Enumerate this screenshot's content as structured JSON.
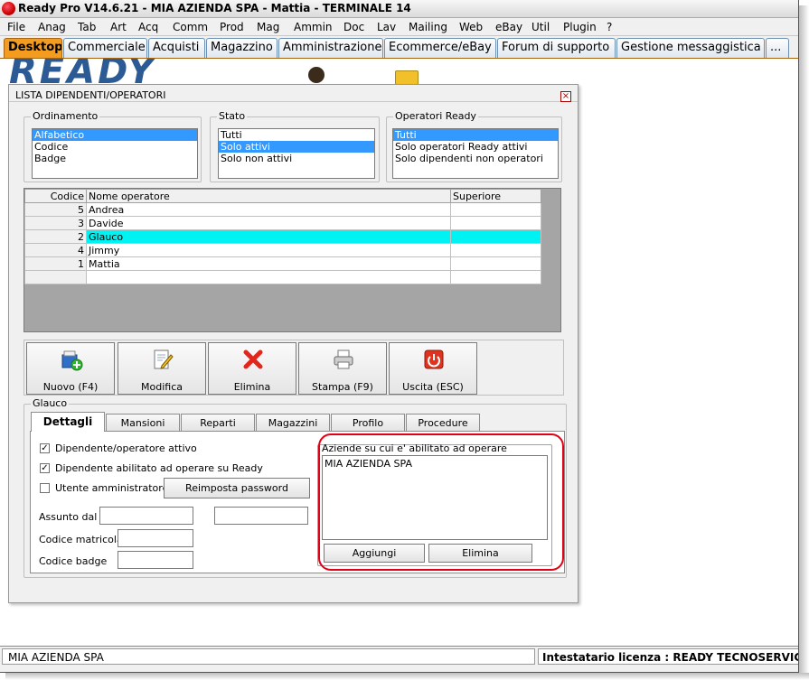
{
  "window": {
    "title": "Ready Pro V14.6.21 - MIA AZIENDA SPA - Mattia - TERMINALE 14"
  },
  "menu": [
    "File",
    "Anag",
    "Tab",
    "Art",
    "Acq",
    "Comm",
    "Prod",
    "Mag",
    "Ammin",
    "Doc",
    "Lav",
    "Mailing",
    "Web",
    "eBay",
    "Util",
    "Plugin",
    "?"
  ],
  "app_tabs": [
    "Desktop",
    "Commerciale",
    "Acquisti",
    "Magazzino",
    "Amministrazione",
    "Ecommerce/eBay",
    "Forum di supporto",
    "Gestione messaggistica",
    "..."
  ],
  "desktop": {
    "logo": "READY"
  },
  "dialog": {
    "title": "LISTA DIPENDENTI/OPERATORI",
    "close_glyph": "×",
    "ordinamento": {
      "label": "Ordinamento",
      "options": [
        "Alfabetico",
        "Codice",
        "Badge"
      ],
      "selected": 0
    },
    "stato": {
      "label": "Stato",
      "options": [
        "Tutti",
        "Solo attivi",
        "Solo non attivi"
      ],
      "selected": 1
    },
    "operatori": {
      "label": "Operatori Ready",
      "options": [
        "Tutti",
        "Solo operatori Ready attivi",
        "Solo dipendenti non operatori"
      ],
      "selected": 0
    },
    "grid": {
      "headers": [
        "Codice",
        "Nome operatore",
        "Superiore"
      ],
      "rows": [
        {
          "code": "5",
          "name": "Andrea",
          "sup": ""
        },
        {
          "code": "3",
          "name": "Davide",
          "sup": ""
        },
        {
          "code": "2",
          "name": "Glauco",
          "sup": ""
        },
        {
          "code": "4",
          "name": "Jimmy",
          "sup": ""
        },
        {
          "code": "1",
          "name": "Mattia",
          "sup": ""
        },
        {
          "code": "",
          "name": "",
          "sup": ""
        }
      ],
      "selected_row": 2
    },
    "toolbar": [
      {
        "label": "Nuovo (F4)",
        "icon": "new-icon"
      },
      {
        "label": "Modifica",
        "icon": "edit-icon"
      },
      {
        "label": "Elimina",
        "icon": "delete-icon"
      },
      {
        "label": "Stampa (F9)",
        "icon": "printer-icon"
      },
      {
        "label": "Uscita (ESC)",
        "icon": "exit-icon"
      }
    ],
    "detail": {
      "group_label": "Glauco",
      "tabs": [
        "Dettagli",
        "Mansioni",
        "Reparti",
        "Magazzini",
        "Profilo",
        "Procedure"
      ],
      "active_tab": 0,
      "checkboxes": [
        {
          "label": "Dipendente/operatore attivo",
          "checked": true
        },
        {
          "label": "Dipendente abilitato ad operare su Ready",
          "checked": true
        },
        {
          "label": "Utente amministratore",
          "checked": false
        }
      ],
      "check_mark": "✓",
      "reset_password_label": "Reimposta password",
      "assunto_label": "Assunto dal",
      "assunto_value": "",
      "assunto_value2": "",
      "matricola_label": "Codice matricola",
      "matricola_value": "",
      "badge_label": "Codice badge",
      "badge_value": "",
      "aziende": {
        "label": "Aziende su cui e' abilitato ad operare",
        "items": [
          "MIA AZIENDA SPA"
        ],
        "add_label": "Aggiungi",
        "remove_label": "Elimina"
      }
    }
  },
  "status": {
    "left": "MIA AZIENDA SPA",
    "right": "Intestatario licenza : READY TECNOSERVICE S.R"
  },
  "colors": {
    "accent_tab": "#f39c1f",
    "selection": "#3399ff",
    "grid_selection": "#00f2f2",
    "highlight_ring": "#e30014"
  }
}
